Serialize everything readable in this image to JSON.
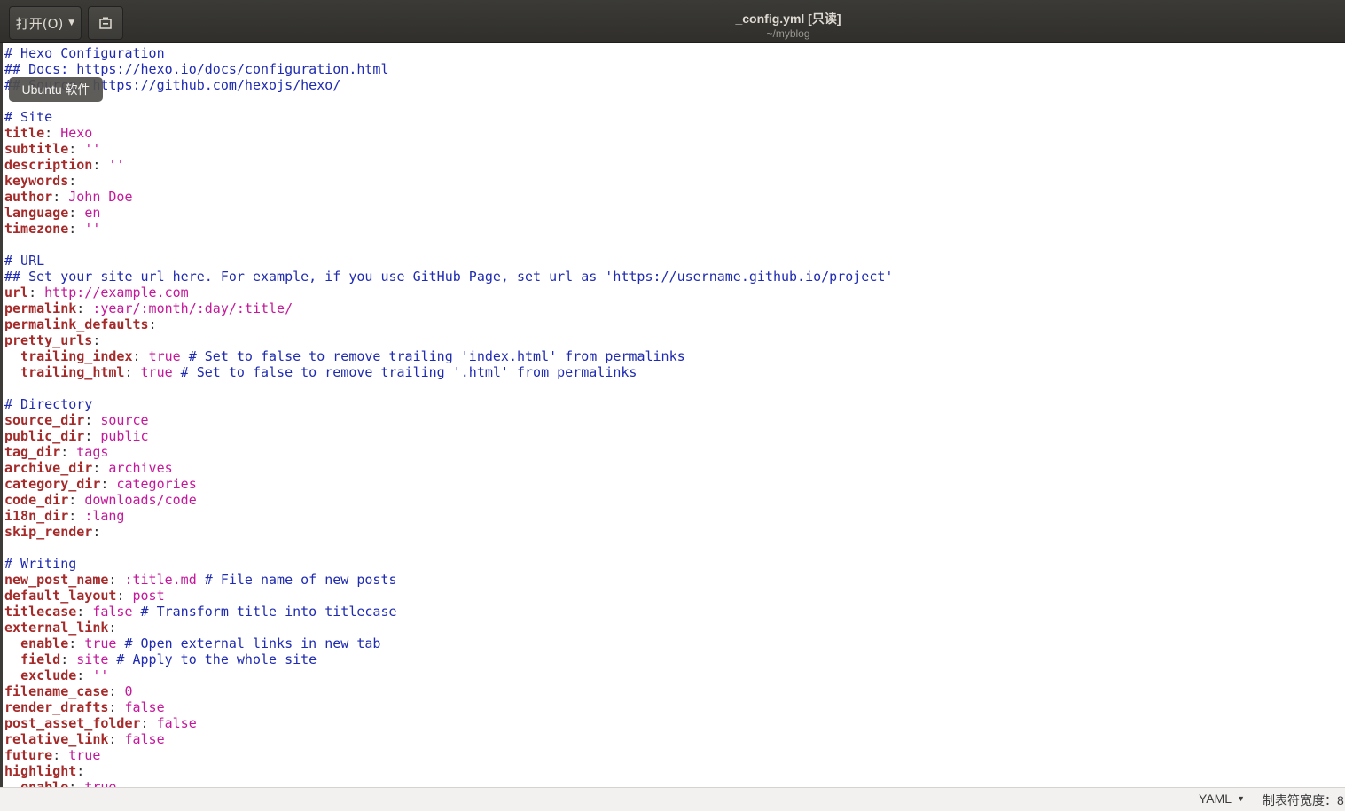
{
  "header": {
    "open_label": "打开(O)",
    "title": "_config.yml [只读]",
    "subtitle": "~/myblog"
  },
  "tooltip": {
    "text": "Ubuntu 软件"
  },
  "editor": {
    "lines": [
      [
        [
          "c",
          "# Hexo Configuration"
        ]
      ],
      [
        [
          "c",
          "## Docs: https://hexo.io/docs/configuration.html"
        ]
      ],
      [
        [
          "c",
          "## Source: https://github.com/hexojs/hexo/"
        ]
      ],
      [],
      [
        [
          "c",
          "# Site"
        ]
      ],
      [
        [
          "k",
          "title"
        ],
        [
          "p",
          ": "
        ],
        [
          "v",
          "Hexo"
        ]
      ],
      [
        [
          "k",
          "subtitle"
        ],
        [
          "p",
          ": "
        ],
        [
          "v",
          "''"
        ]
      ],
      [
        [
          "k",
          "description"
        ],
        [
          "p",
          ": "
        ],
        [
          "v",
          "''"
        ]
      ],
      [
        [
          "k",
          "keywords"
        ],
        [
          "p",
          ":"
        ]
      ],
      [
        [
          "k",
          "author"
        ],
        [
          "p",
          ": "
        ],
        [
          "v",
          "John Doe"
        ]
      ],
      [
        [
          "k",
          "language"
        ],
        [
          "p",
          ": "
        ],
        [
          "v",
          "en"
        ]
      ],
      [
        [
          "k",
          "timezone"
        ],
        [
          "p",
          ": "
        ],
        [
          "v",
          "''"
        ]
      ],
      [],
      [
        [
          "c",
          "# URL"
        ]
      ],
      [
        [
          "c",
          "## Set your site url here. For example, if you use GitHub Page, set url as 'https://username.github.io/project'"
        ]
      ],
      [
        [
          "k",
          "url"
        ],
        [
          "p",
          ": "
        ],
        [
          "v",
          "http://example.com"
        ]
      ],
      [
        [
          "k",
          "permalink"
        ],
        [
          "p",
          ": "
        ],
        [
          "v",
          ":year/:month/:day/:title/"
        ]
      ],
      [
        [
          "k",
          "permalink_defaults"
        ],
        [
          "p",
          ":"
        ]
      ],
      [
        [
          "k",
          "pretty_urls"
        ],
        [
          "p",
          ":"
        ]
      ],
      [
        [
          "p",
          "  "
        ],
        [
          "k",
          "trailing_index"
        ],
        [
          "p",
          ": "
        ],
        [
          "v",
          "true"
        ],
        [
          "c",
          " # Set to false to remove trailing 'index.html' from permalinks"
        ]
      ],
      [
        [
          "p",
          "  "
        ],
        [
          "k",
          "trailing_html"
        ],
        [
          "p",
          ": "
        ],
        [
          "v",
          "true"
        ],
        [
          "c",
          " # Set to false to remove trailing '.html' from permalinks"
        ]
      ],
      [],
      [
        [
          "c",
          "# Directory"
        ]
      ],
      [
        [
          "k",
          "source_dir"
        ],
        [
          "p",
          ": "
        ],
        [
          "v",
          "source"
        ]
      ],
      [
        [
          "k",
          "public_dir"
        ],
        [
          "p",
          ": "
        ],
        [
          "v",
          "public"
        ]
      ],
      [
        [
          "k",
          "tag_dir"
        ],
        [
          "p",
          ": "
        ],
        [
          "v",
          "tags"
        ]
      ],
      [
        [
          "k",
          "archive_dir"
        ],
        [
          "p",
          ": "
        ],
        [
          "v",
          "archives"
        ]
      ],
      [
        [
          "k",
          "category_dir"
        ],
        [
          "p",
          ": "
        ],
        [
          "v",
          "categories"
        ]
      ],
      [
        [
          "k",
          "code_dir"
        ],
        [
          "p",
          ": "
        ],
        [
          "v",
          "downloads/code"
        ]
      ],
      [
        [
          "k",
          "i18n_dir"
        ],
        [
          "p",
          ": "
        ],
        [
          "v",
          ":lang"
        ]
      ],
      [
        [
          "k",
          "skip_render"
        ],
        [
          "p",
          ":"
        ]
      ],
      [],
      [
        [
          "c",
          "# Writing"
        ]
      ],
      [
        [
          "k",
          "new_post_name"
        ],
        [
          "p",
          ": "
        ],
        [
          "v",
          ":title.md"
        ],
        [
          "c",
          " # File name of new posts"
        ]
      ],
      [
        [
          "k",
          "default_layout"
        ],
        [
          "p",
          ": "
        ],
        [
          "v",
          "post"
        ]
      ],
      [
        [
          "k",
          "titlecase"
        ],
        [
          "p",
          ": "
        ],
        [
          "v",
          "false"
        ],
        [
          "c",
          " # Transform title into titlecase"
        ]
      ],
      [
        [
          "k",
          "external_link"
        ],
        [
          "p",
          ":"
        ]
      ],
      [
        [
          "p",
          "  "
        ],
        [
          "k",
          "enable"
        ],
        [
          "p",
          ": "
        ],
        [
          "v",
          "true"
        ],
        [
          "c",
          " # Open external links in new tab"
        ]
      ],
      [
        [
          "p",
          "  "
        ],
        [
          "k",
          "field"
        ],
        [
          "p",
          ": "
        ],
        [
          "v",
          "site"
        ],
        [
          "c",
          " # Apply to the whole site"
        ]
      ],
      [
        [
          "p",
          "  "
        ],
        [
          "k",
          "exclude"
        ],
        [
          "p",
          ": "
        ],
        [
          "v",
          "''"
        ]
      ],
      [
        [
          "k",
          "filename_case"
        ],
        [
          "p",
          ": "
        ],
        [
          "v",
          "0"
        ]
      ],
      [
        [
          "k",
          "render_drafts"
        ],
        [
          "p",
          ": "
        ],
        [
          "v",
          "false"
        ]
      ],
      [
        [
          "k",
          "post_asset_folder"
        ],
        [
          "p",
          ": "
        ],
        [
          "v",
          "false"
        ]
      ],
      [
        [
          "k",
          "relative_link"
        ],
        [
          "p",
          ": "
        ],
        [
          "v",
          "false"
        ]
      ],
      [
        [
          "k",
          "future"
        ],
        [
          "p",
          ": "
        ],
        [
          "v",
          "true"
        ]
      ],
      [
        [
          "k",
          "highlight"
        ],
        [
          "p",
          ":"
        ]
      ],
      [
        [
          "p",
          "  "
        ],
        [
          "k",
          "enable"
        ],
        [
          "p",
          ": "
        ],
        [
          "v",
          "true"
        ]
      ]
    ]
  },
  "statusbar": {
    "language": "YAML",
    "tab_width_label": "制表符宽度：8"
  },
  "colors": {
    "comment": "#1f2bb2",
    "key": "#a52a2a",
    "value": "#c5179b",
    "headerbar": "#3b3a36"
  },
  "icons": {
    "open_dropdown": "chevron-down-icon",
    "document_button": "recent-documents-icon",
    "language_dropdown": "chevron-down-icon"
  }
}
